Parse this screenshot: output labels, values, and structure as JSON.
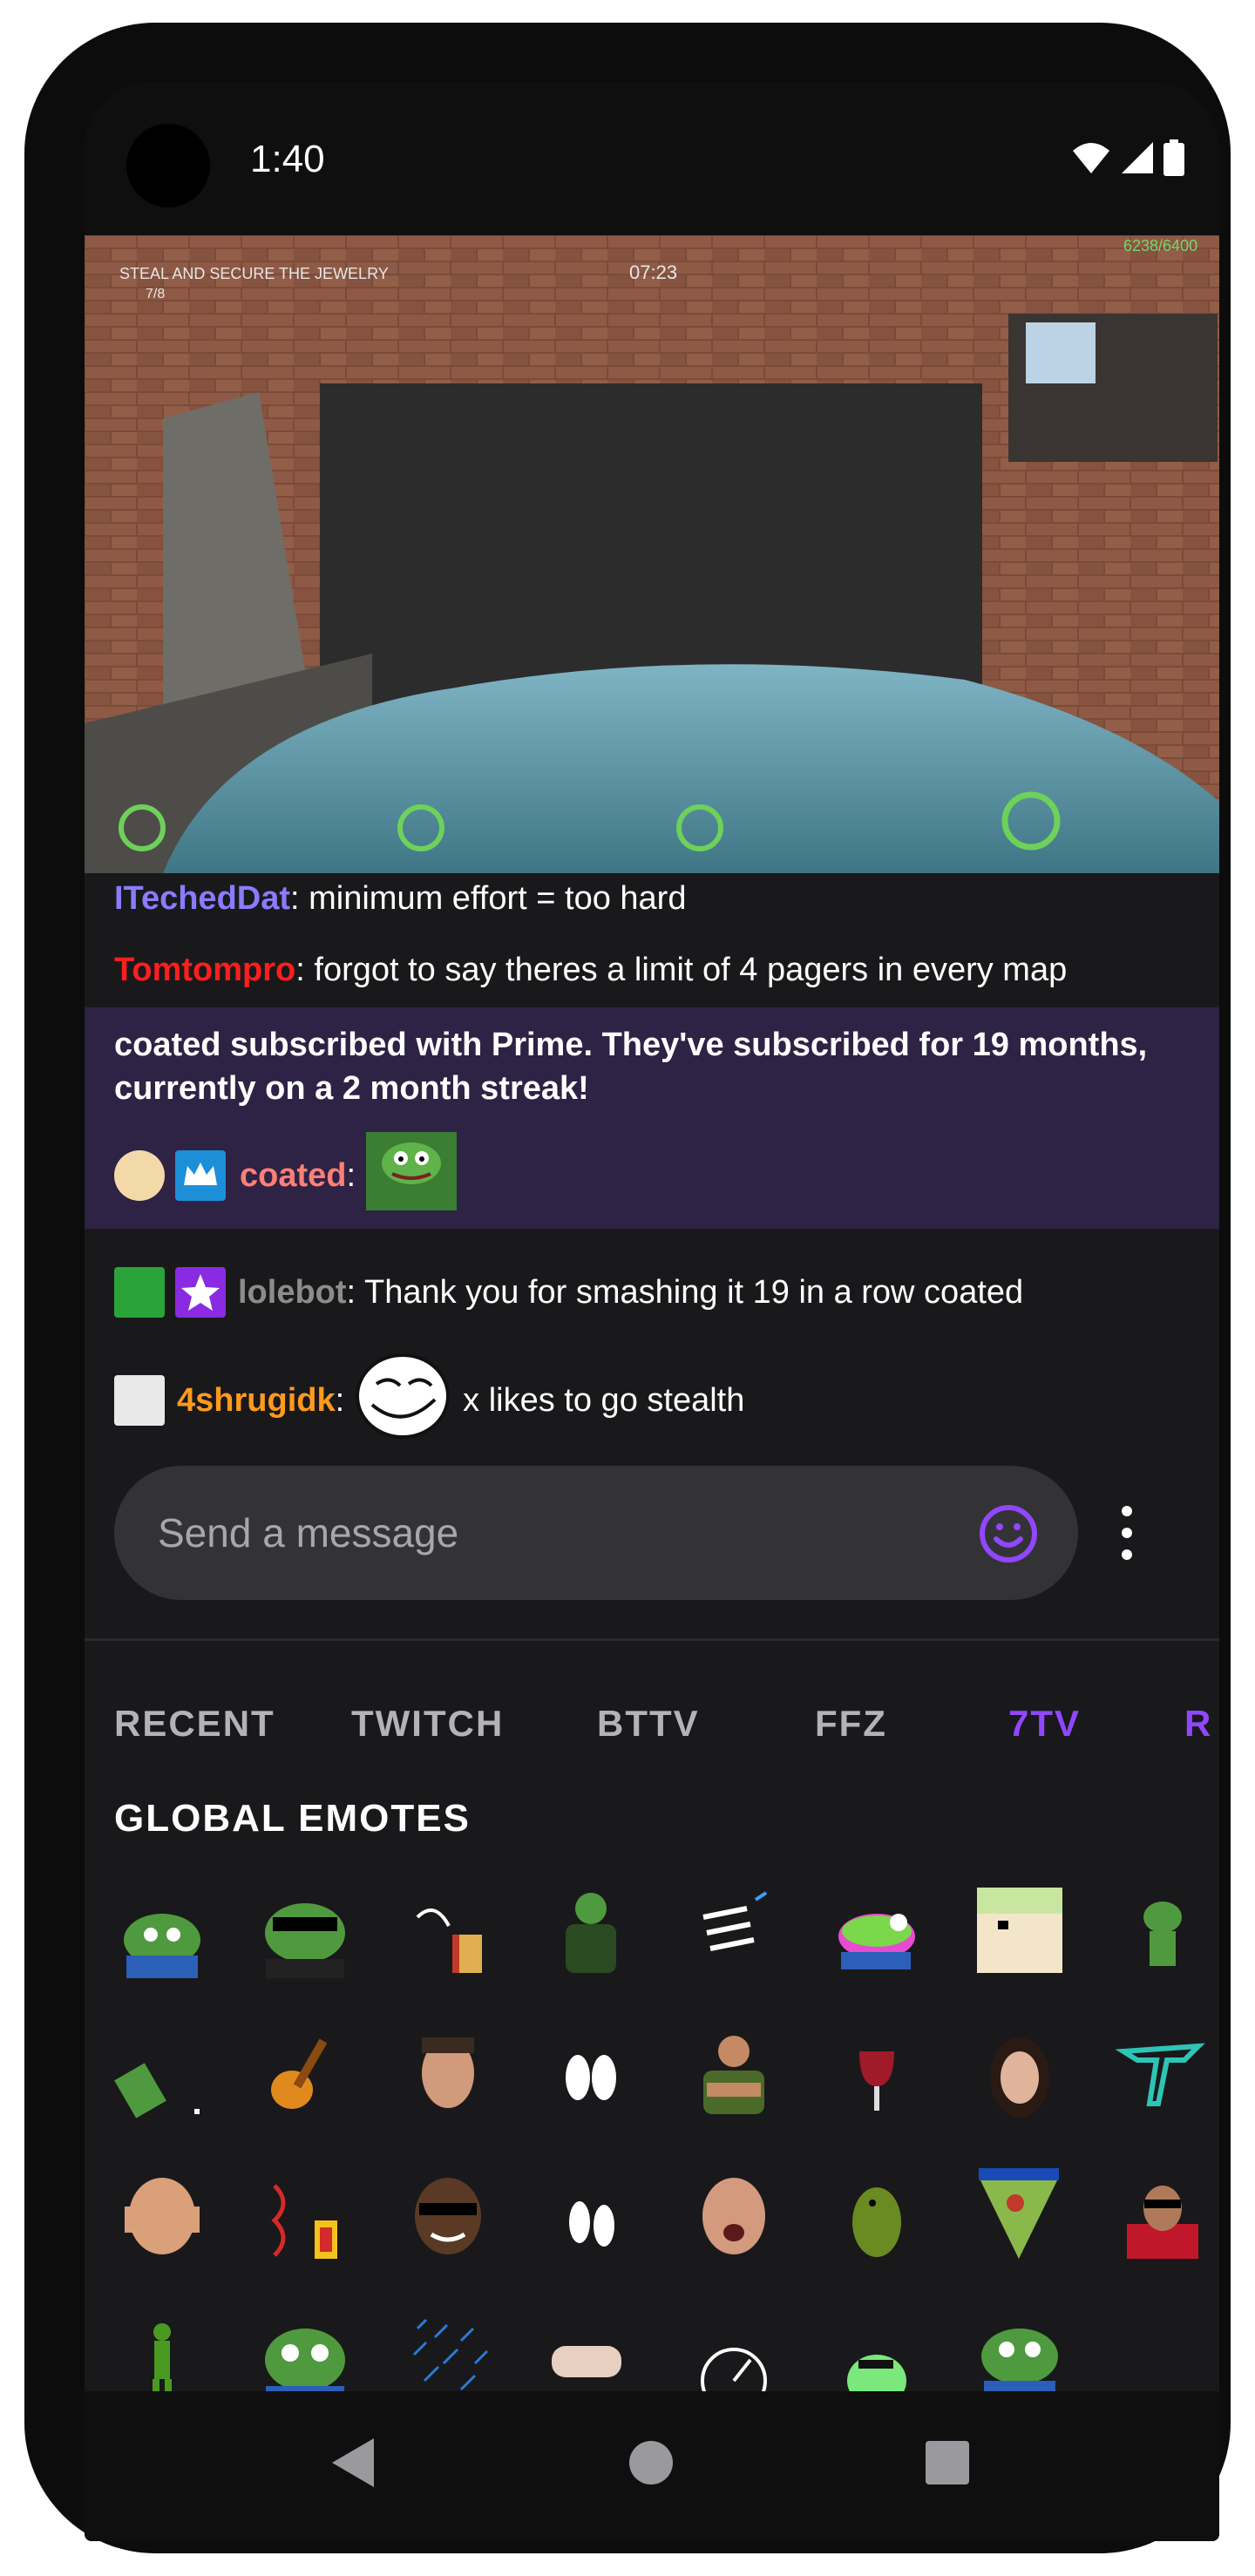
{
  "status_bar": {
    "time": "1:40"
  },
  "video": {
    "objective_line1": "STEAL AND SECURE THE JEWELRY",
    "objective_line2": "7/8",
    "timer": "07:23",
    "score": "6238/6400"
  },
  "chat": {
    "messages": [
      {
        "user": "ITechedDat",
        "color": "#8a7bff",
        "text": ": minimum effort = too hard"
      },
      {
        "user": "Tomtompro",
        "color": "#ff1e1e",
        "text": ": forgot to say theres a limit of 4 pagers in every map"
      }
    ],
    "subscription": {
      "notice": "coated subscribed with Prime. They've subscribed for 19 months, currently on a 2 month streak!",
      "user": "coated",
      "color": "#ff7f76",
      "separator": ":"
    },
    "bot_message": {
      "user": "lolebot",
      "color": "#8c8c8c",
      "text": ": Thank you for smashing it 19 in a row coated"
    },
    "last_message": {
      "user": "4shrugidk",
      "color": "#ff9a1e",
      "separator": ":",
      "text": "x likes to go stealth"
    }
  },
  "input": {
    "placeholder": "Send a message"
  },
  "emote_tabs": [
    "RECENT",
    "TWITCH",
    "BTTV",
    "FFZ",
    "7TV",
    "R"
  ],
  "active_tab": "7TV",
  "section_title": "GLOBAL EMOTES",
  "colors": {
    "accent": "#9146ff",
    "sub_bg": "#2e2245",
    "panel": "#19191b"
  }
}
